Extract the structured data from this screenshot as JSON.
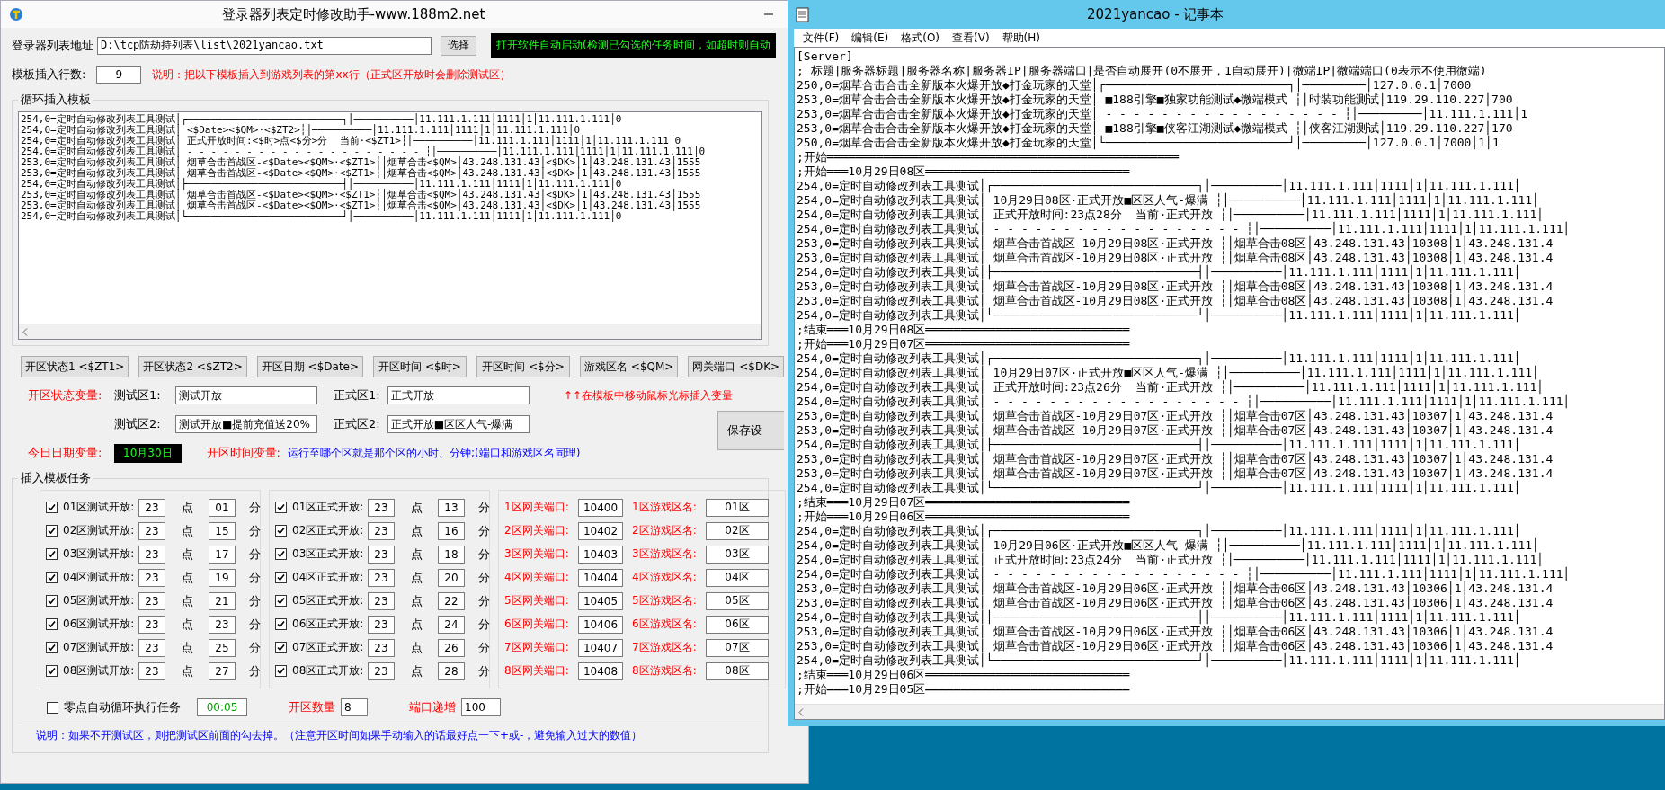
{
  "app_window": {
    "title": "登录器列表定时修改助手-www.188m2.net",
    "list_path": {
      "label": "登录器列表地址",
      "value": "D:\\tcp防劫持列表\\list\\2021yancao.txt",
      "button": "选择"
    },
    "banner": "打开软件自动启动(检测已勾选的任务时间，如超时则自动",
    "insert_row": {
      "label": "模板插入行数:",
      "value": "9",
      "note": "说明：把以下模板插入到游戏列表的第xx行（正式区开放时会删除测试区）"
    },
    "template": {
      "title": "循环插入模板",
      "lines": [
        "254,0=定时自动修改列表工具测试│┌──────────────────────────┐│──────────│11.111.1.111│1111│1│11.111.1.111│0",
        "254,0=定时自动修改列表工具测试│ <$Date><$QM>·<$ZT2>┆│──────────│11.111.1.111│1111│1│11.111.1.111│0",
        "254,0=定时自动修改列表工具测试│ 正式开放时间:<$时>点<$分>分  当前·<$ZT1>┆│──────────│11.111.1.111│1111│1│11.111.1.111│0",
        "254,0=定时自动修改列表工具测试│ - - - - - - - - - - - - - - - - - - - - ┆│──────────│11.111.1.111│1111│1│11.111.1.111│0",
        "253,0=定时自动修改列表工具测试│ 烟草合击首战区-<$Date><$QM>·<$ZT1>┆│烟草合击<$QM>│43.248.131.43│<$DK>│1│43.248.131.43│1555",
        "253,0=定时自动修改列表工具测试│ 烟草合击首战区-<$Date><$QM>·<$ZT1>┆│烟草合击<$QM>│43.248.131.43│<$DK>│1│43.248.131.43│1555",
        "254,0=定时自动修改列表工具测试│├──────────────────────────┤│──────────│11.111.1.111│1111│1│11.111.1.111│0",
        "253,0=定时自动修改列表工具测试│ 烟草合击首战区-<$Date><$QM>·<$ZT1>┆│烟草合击<$QM>│43.248.131.43│<$DK>│1│43.248.131.43│1555",
        "253,0=定时自动修改列表工具测试│ 烟草合击首战区-<$Date><$QM>·<$ZT1>┆│烟草合击<$QM>│43.248.131.43│<$DK>│1│43.248.131.43│1555",
        "254,0=定时自动修改列表工具测试│└──────────────────────────┘│──────────│11.111.1.111│1111│1│11.111.1.111│0"
      ]
    },
    "variable_buttons": [
      "开区状态1 <$ZT1>",
      "开区状态2 <$ZT2>",
      "开区日期 <$Date>",
      "开区时间 <$时>",
      "开区时间 <$分>",
      "游戏区名 <$QM>",
      "网关端口 <$DK>"
    ],
    "status_vars": {
      "label": "开区状态变量:",
      "hint": "↑↑在模板中移动鼠标光标插入变量",
      "fields": [
        {
          "label": "测试区1:",
          "value": "测试开放"
        },
        {
          "label": "正式区1:",
          "value": "正式开放"
        },
        {
          "label": "测试区2:",
          "value": "测试开放■提前充值送20%"
        },
        {
          "label": "正式区2:",
          "value": "正式开放■区区人气-爆满"
        }
      ]
    },
    "save_button": "保存设",
    "date_var": {
      "label": "今日日期变量:",
      "value": "10月30日"
    },
    "time_var": {
      "label": "开区时间变量:",
      "note": "运行至哪个区就是那个区的小时、分钟;(端口和游戏区名同理)"
    },
    "tasks": {
      "title": "插入模板任务",
      "test": [
        {
          "checked": true,
          "label": "01区测试开放:",
          "hour": "23",
          "hour_unit": "点",
          "minute": "01",
          "minute_unit": "分"
        },
        {
          "checked": true,
          "label": "02区测试开放:",
          "hour": "23",
          "hour_unit": "点",
          "minute": "15",
          "minute_unit": "分"
        },
        {
          "checked": true,
          "label": "03区测试开放:",
          "hour": "23",
          "hour_unit": "点",
          "minute": "17",
          "minute_unit": "分"
        },
        {
          "checked": true,
          "label": "04区测试开放:",
          "hour": "23",
          "hour_unit": "点",
          "minute": "19",
          "minute_unit": "分"
        },
        {
          "checked": true,
          "label": "05区测试开放:",
          "hour": "23",
          "hour_unit": "点",
          "minute": "21",
          "minute_unit": "分"
        },
        {
          "checked": true,
          "label": "06区测试开放:",
          "hour": "23",
          "hour_unit": "点",
          "minute": "23",
          "minute_unit": "分"
        },
        {
          "checked": true,
          "label": "07区测试开放:",
          "hour": "23",
          "hour_unit": "点",
          "minute": "25",
          "minute_unit": "分"
        },
        {
          "checked": true,
          "label": "08区测试开放:",
          "hour": "23",
          "hour_unit": "点",
          "minute": "27",
          "minute_unit": "分"
        }
      ],
      "formal": [
        {
          "checked": true,
          "label": "01区正式开放:",
          "hour": "23",
          "hour_unit": "点",
          "minute": "13",
          "minute_unit": "分"
        },
        {
          "checked": true,
          "label": "02区正式开放:",
          "hour": "23",
          "hour_unit": "点",
          "minute": "16",
          "minute_unit": "分"
        },
        {
          "checked": true,
          "label": "03区正式开放:",
          "hour": "23",
          "hour_unit": "点",
          "minute": "18",
          "minute_unit": "分"
        },
        {
          "checked": true,
          "label": "04区正式开放:",
          "hour": "23",
          "hour_unit": "点",
          "minute": "20",
          "minute_unit": "分"
        },
        {
          "checked": true,
          "label": "05区正式开放:",
          "hour": "23",
          "hour_unit": "点",
          "minute": "22",
          "minute_unit": "分"
        },
        {
          "checked": true,
          "label": "06区正式开放:",
          "hour": "23",
          "hour_unit": "点",
          "minute": "24",
          "minute_unit": "分"
        },
        {
          "checked": true,
          "label": "07区正式开放:",
          "hour": "23",
          "hour_unit": "点",
          "minute": "26",
          "minute_unit": "分"
        },
        {
          "checked": true,
          "label": "08区正式开放:",
          "hour": "23",
          "hour_unit": "点",
          "minute": "28",
          "minute_unit": "分"
        }
      ],
      "ports": [
        {
          "port_label": "1区网关端口:",
          "port": "10400",
          "name_label": "1区游戏区名:",
          "name": "01区"
        },
        {
          "port_label": "2区网关端口:",
          "port": "10402",
          "name_label": "2区游戏区名:",
          "name": "02区"
        },
        {
          "port_label": "3区网关端口:",
          "port": "10403",
          "name_label": "3区游戏区名:",
          "name": "03区"
        },
        {
          "port_label": "4区网关端口:",
          "port": "10404",
          "name_label": "4区游戏区名:",
          "name": "04区"
        },
        {
          "port_label": "5区网关端口:",
          "port": "10405",
          "name_label": "5区游戏区名:",
          "name": "05区"
        },
        {
          "port_label": "6区网关端口:",
          "port": "10406",
          "name_label": "6区游戏区名:",
          "name": "06区"
        },
        {
          "port_label": "7区网关端口:",
          "port": "10407",
          "name_label": "7区游戏区名:",
          "name": "07区"
        },
        {
          "port_label": "8区网关端口:",
          "port": "10408",
          "name_label": "8区游戏区名:",
          "name": "08区"
        }
      ]
    },
    "options": {
      "loop": {
        "checked": false,
        "label": "零点自动循环执行任务",
        "time": "00:05"
      },
      "count": {
        "label": "开区数量",
        "value": "8"
      },
      "increment": {
        "label": "端口递增",
        "value": "100"
      }
    },
    "note": "说明：如果不开测试区，则把测试区前面的勾去掉。（注意开区时间如果手动输入的话最好点一下+或-，避免输入过大的数值）"
  },
  "notepad": {
    "title": "2021yancao - 记事本",
    "menu": [
      "文件(F)",
      "编辑(E)",
      "格式(O)",
      "查看(V)",
      "帮助(H)"
    ],
    "lines": [
      "[Server]",
      "; 标题|服务器标题|服务器名称|服务器IP|服务器端口|是否自动展开(0不展开，1自动展开)|微端IP|微端端口(0表示不使用微端)",
      "250,0=烟草合击合击全新版本火爆开放◆打金玩家的天堂│┌──────────────────────────┐│─────────│127.0.0.1│7000",
      "253,0=烟草合击合击全新版本火爆开放◆打金玩家的天堂│ ■188引擎■独家功能测试◆微端模式 ┆│时装功能测试│119.29.110.227│700",
      "253,0=烟草合击合击全新版本火爆开放◆打金玩家的天堂│ - - - - - - - - - - - - - - - - - ┆│─────────│11.111.1.111│1",
      "253,0=烟草合击合击全新版本火爆开放◆打金玩家的天堂│ ■188引擎■侠客江湖测试◆微端模式 ┆│侠客江湖测试│119.29.110.227│170",
      "250,0=烟草合击合击全新版本火爆开放◆打金玩家的天堂│└──────────────────────────┘│─────────│127.0.0.1│7000│1│1",
      ";开始══════════════════════════════════════════════════",
      ";开始═══10月29日08区═════════════════════════════",
      "254,0=定时自动修改列表工具测试│┌─────────────────────────────┐│──────────│11.111.1.111│1111│1│11.111.1.111│",
      "254,0=定时自动修改列表工具测试│ 10月29日08区·正式开放■区区人气-爆满 ┆│──────────│11.111.1.111│1111│1│11.111.1.111│",
      "254,0=定时自动修改列表工具测试│ 正式开放时间:23点28分  当前·正式开放 ┆│──────────│11.111.1.111│1111│1│11.111.1.111│",
      "254,0=定时自动修改列表工具测试│ - - - - - - - - - - - - - - - - - - ┆│──────────│11.111.1.111│1111│1│11.111.1.111│",
      "253,0=定时自动修改列表工具测试│ 烟草合击首战区-10月29日08区·正式开放 ┆│烟草合击08区│43.248.131.43│10308│1│43.248.131.4",
      "253,0=定时自动修改列表工具测试│ 烟草合击首战区-10月29日08区·正式开放 ┆│烟草合击08区│43.248.131.43│10308│1│43.248.131.4",
      "254,0=定时自动修改列表工具测试│├─────────────────────────────┤│──────────│11.111.1.111│1111│1│11.111.1.111│",
      "253,0=定时自动修改列表工具测试│ 烟草合击首战区-10月29日08区·正式开放 ┆│烟草合击08区│43.248.131.43│10308│1│43.248.131.4",
      "253,0=定时自动修改列表工具测试│ 烟草合击首战区-10月29日08区·正式开放 ┆│烟草合击08区│43.248.131.43│10308│1│43.248.131.4",
      "254,0=定时自动修改列表工具测试│└─────────────────────────────┘│──────────│11.111.1.111│1111│1│11.111.1.111│",
      ";结束═══10月29日08区═════════════════════════════",
      ";开始═══10月29日07区═════════════════════════════",
      "254,0=定时自动修改列表工具测试│┌─────────────────────────────┐│──────────│11.111.1.111│1111│1│11.111.1.111│",
      "254,0=定时自动修改列表工具测试│ 10月29日07区·正式开放■区区人气-爆满 ┆│──────────│11.111.1.111│1111│1│11.111.1.111│",
      "254,0=定时自动修改列表工具测试│ 正式开放时间:23点26分  当前·正式开放 ┆│──────────│11.111.1.111│1111│1│11.111.1.111│",
      "254,0=定时自动修改列表工具测试│ - - - - - - - - - - - - - - - - - - ┆│──────────│11.111.1.111│1111│1│11.111.1.111│",
      "253,0=定时自动修改列表工具测试│ 烟草合击首战区-10月29日07区·正式开放 ┆│烟草合击07区│43.248.131.43│10307│1│43.248.131.4",
      "253,0=定时自动修改列表工具测试│ 烟草合击首战区-10月29日07区·正式开放 ┆│烟草合击07区│43.248.131.43│10307│1│43.248.131.4",
      "254,0=定时自动修改列表工具测试│├─────────────────────────────┤│──────────│11.111.1.111│1111│1│11.111.1.111│",
      "253,0=定时自动修改列表工具测试│ 烟草合击首战区-10月29日07区·正式开放 ┆│烟草合击07区│43.248.131.43│10307│1│43.248.131.4",
      "253,0=定时自动修改列表工具测试│ 烟草合击首战区-10月29日07区·正式开放 ┆│烟草合击07区│43.248.131.43│10307│1│43.248.131.4",
      "254,0=定时自动修改列表工具测试│└─────────────────────────────┘│──────────│11.111.1.111│1111│1│11.111.1.111│",
      ";结束═══10月29日07区═════════════════════════════",
      ";开始═══10月29日06区═════════════════════════════",
      "254,0=定时自动修改列表工具测试│┌─────────────────────────────┐│──────────│11.111.1.111│1111│1│11.111.1.111│",
      "254,0=定时自动修改列表工具测试│ 10月29日06区·正式开放■区区人气-爆满 ┆│──────────│11.111.1.111│1111│1│11.111.1.111│",
      "254,0=定时自动修改列表工具测试│ 正式开放时间:23点24分  当前·正式开放 ┆│──────────│11.111.1.111│1111│1│11.111.1.111│",
      "254,0=定时自动修改列表工具测试│ - - - - - - - - - - - - - - - - - - ┆│──────────│11.111.1.111│1111│1│11.111.1.111│",
      "253,0=定时自动修改列表工具测试│ 烟草合击首战区-10月29日06区·正式开放 ┆│烟草合击06区│43.248.131.43│10306│1│43.248.131.4",
      "253,0=定时自动修改列表工具测试│ 烟草合击首战区-10月29日06区·正式开放 ┆│烟草合击06区│43.248.131.43│10306│1│43.248.131.4",
      "254,0=定时自动修改列表工具测试│├─────────────────────────────┤│──────────│11.111.1.111│1111│1│11.111.1.111│",
      "253,0=定时自动修改列表工具测试│ 烟草合击首战区-10月29日06区·正式开放 ┆│烟草合击06区│43.248.131.43│10306│1│43.248.131.4",
      "253,0=定时自动修改列表工具测试│ 烟草合击首战区-10月29日06区·正式开放 ┆│烟草合击06区│43.248.131.43│10306│1│43.248.131.4",
      "254,0=定时自动修改列表工具测试│└─────────────────────────────┘│──────────│11.111.1.111│1111│1│11.111.1.111│",
      ";结束═══10月29日06区═════════════════════════════",
      ";开始═══10月29日05区═════════════════════════════"
    ]
  }
}
